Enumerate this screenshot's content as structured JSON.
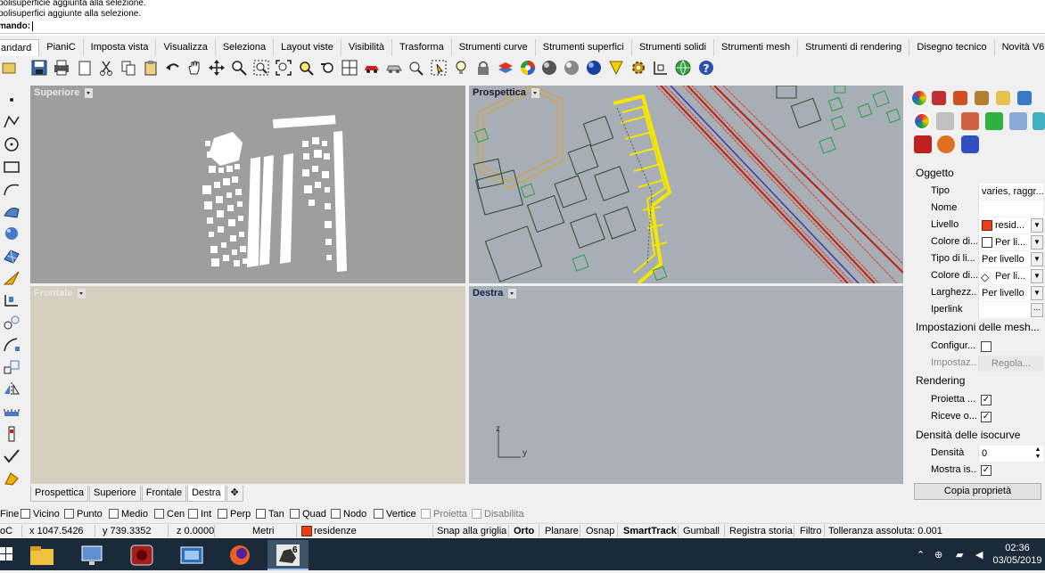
{
  "command_history": [
    "polisuperficie aggiunta alla selezione.",
    "polisuperfici aggiunte alla selezione."
  ],
  "command_prompt": "mando:",
  "menu_tabs": [
    "andard",
    "PianiC",
    "Imposta vista",
    "Visualizza",
    "Seleziona",
    "Layout viste",
    "Visibilità",
    "Trasforma",
    "Strumenti curve",
    "Strumenti superfici",
    "Strumenti solidi",
    "Strumenti mesh",
    "Strumenti di rendering",
    "Disegno tecnico",
    "Novità V6"
  ],
  "viewports": {
    "top": "Superiore",
    "perspective": "Prospettica",
    "front": "Frontale",
    "right": "Destra"
  },
  "axis_labels": {
    "z": "z",
    "y": "y"
  },
  "viewport_tabs": [
    "Prospettica",
    "Superiore",
    "Frontale",
    "Destra"
  ],
  "properties": {
    "section_object": "Oggetto",
    "rows": [
      {
        "label": "Tipo",
        "value": "varies, raggr..."
      },
      {
        "label": "Nome",
        "value": ""
      },
      {
        "label": "Livello",
        "value": "resid..."
      },
      {
        "label": "Colore di...",
        "value": "Per li..."
      },
      {
        "label": "Tipo di li...",
        "value": "Per livello"
      },
      {
        "label": "Colore di...",
        "value": "Per li..."
      },
      {
        "label": "Larghezz...",
        "value": "Per livello"
      },
      {
        "label": "Iperlink",
        "value": "..."
      }
    ],
    "section_mesh": "Impostazioni delle mesh...",
    "mesh_config": "Configur...",
    "mesh_settings": "Impostaz...",
    "mesh_adjust": "Regola...",
    "section_render": "Rendering",
    "render_cast": "Proietta ...",
    "render_receive": "Riceve o...",
    "section_iso": "Densità delle isocurve",
    "iso_density": "Densità",
    "iso_density_value": "0",
    "iso_show": "Mostra is...",
    "copy_button": "Copia proprietà"
  },
  "osnap": [
    "Fine",
    "Vicino",
    "Punto",
    "Medio",
    "Cen",
    "Int",
    "Perp",
    "Tan",
    "Quad",
    "Nodo",
    "Vertice",
    "Proietta",
    "Disabilita"
  ],
  "status": {
    "cplane": "oC",
    "x": "x 1047.5426",
    "y": "y 739.3352",
    "z": "z 0.0000",
    "units": "Metri",
    "layer": "residenze",
    "grid_snap": "Snap alla griglia",
    "ortho": "Orto",
    "planar": "Planare",
    "osnap": "Osnap",
    "smarttrack": "SmartTrack",
    "gumball": "Gumball",
    "history": "Registra storia",
    "filter": "Filtro",
    "tolerance": "Tolleranza assoluta: 0.001"
  },
  "taskbar": {
    "time": "02:36",
    "date": "03/05/2019",
    "rhino_badge": "6"
  },
  "colors": {
    "layer": "#e8401c",
    "selection": "#f4e600",
    "accent": "#3a78c8"
  }
}
